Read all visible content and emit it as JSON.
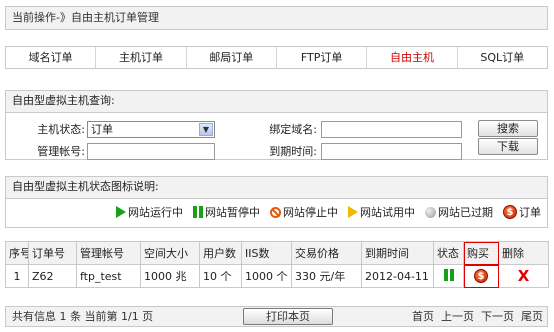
{
  "breadcrumb": "当前操作-》自由主机订单管理",
  "tabs": [
    "域名订单",
    "主机订单",
    "邮局订单",
    "FTP订单",
    "自由主机",
    "SQL订单"
  ],
  "query": {
    "title": "自由型虚拟主机查询:",
    "status_label": "主机状态:",
    "status_value": "订单",
    "domain_label": "绑定域名:",
    "domain_value": "",
    "account_label": "管理帐号:",
    "account_value": "",
    "expire_label": "到期时间:",
    "expire_value": "",
    "search_button": "搜索",
    "download_button": "下载"
  },
  "legend": {
    "title": "自由型虚拟主机状态图标说明:",
    "items": [
      {
        "icon": "play-triangle-green-icon",
        "label": "网站运行中"
      },
      {
        "icon": "pause-green-icon",
        "label": "网站暂停中"
      },
      {
        "icon": "ban-orange-icon",
        "label": "网站停止中"
      },
      {
        "icon": "play-triangle-yellow-icon",
        "label": "网站试用中"
      },
      {
        "icon": "gray-circle-icon",
        "label": "网站已过期"
      },
      {
        "icon": "dollar-coin-icon",
        "label": "订单"
      }
    ]
  },
  "table": {
    "headers": [
      "序号",
      "订单号",
      "管理帐号",
      "空间大小",
      "用户数",
      "IIS数",
      "交易价格",
      "到期时间",
      "状态",
      "购买",
      "删除"
    ],
    "rows": [
      {
        "index": "1",
        "order_no": "Z62",
        "account": "ftp_test",
        "space": "1000 兆",
        "users": "10 个",
        "iis": "1000 个",
        "price": "330 元/年",
        "expire": "2012-04-11",
        "status_icon": "pause-green-icon",
        "buy_icon": "dollar-coin-icon",
        "delete": "X"
      }
    ]
  },
  "footer": {
    "summary": "共有信息 1 条 当前第 1/1 页",
    "print_button": "打印本页",
    "pager": [
      "首页",
      "上一页",
      "下一页",
      "尾页"
    ]
  },
  "colors": {
    "active_tab": "#d40000",
    "highlight_border": "#e00000",
    "status_green": "#19a019"
  }
}
